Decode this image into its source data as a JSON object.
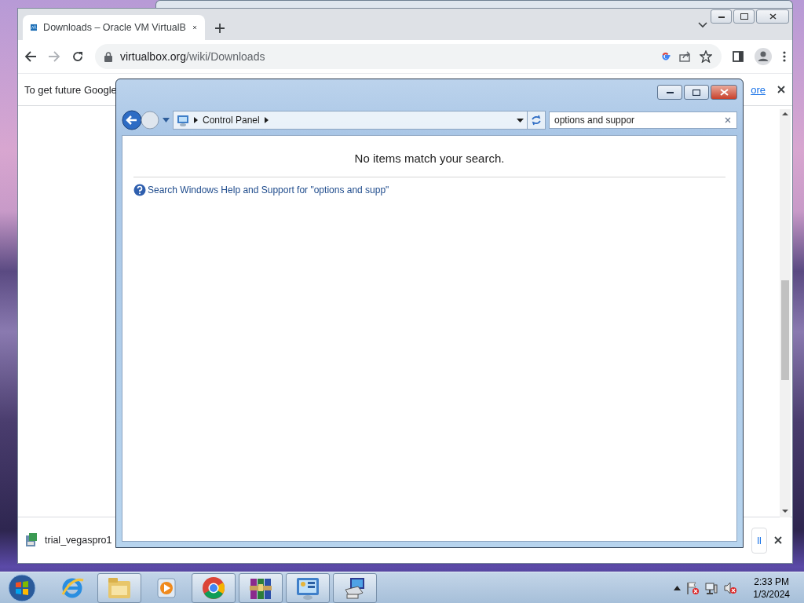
{
  "browser": {
    "tab": {
      "title": "Downloads – Oracle VM VirtualB"
    },
    "address": {
      "host": "virtualbox.org",
      "path": "/wiki/Downloads"
    },
    "infobar": {
      "message": "To get future Google",
      "link": "ore"
    },
    "download": {
      "filename": "trial_vegaspro1",
      "button": "ll"
    }
  },
  "explorer": {
    "breadcrumb": [
      "Control Panel"
    ],
    "search": {
      "value": "options and suppor"
    },
    "message": "No items match your search.",
    "help_link": "Search Windows Help and Support for \"options and supp\""
  },
  "taskbar": {
    "apps": [
      {
        "kind": "browser",
        "framed": false
      },
      {
        "kind": "folder",
        "framed": true
      },
      {
        "kind": "media",
        "framed": false
      },
      {
        "kind": "chrome",
        "framed": true
      },
      {
        "kind": "archive",
        "framed": true
      },
      {
        "kind": "panel",
        "framed": true
      },
      {
        "kind": "setup",
        "framed": true
      }
    ],
    "time": "2:33 PM",
    "date": "1/3/2024"
  }
}
